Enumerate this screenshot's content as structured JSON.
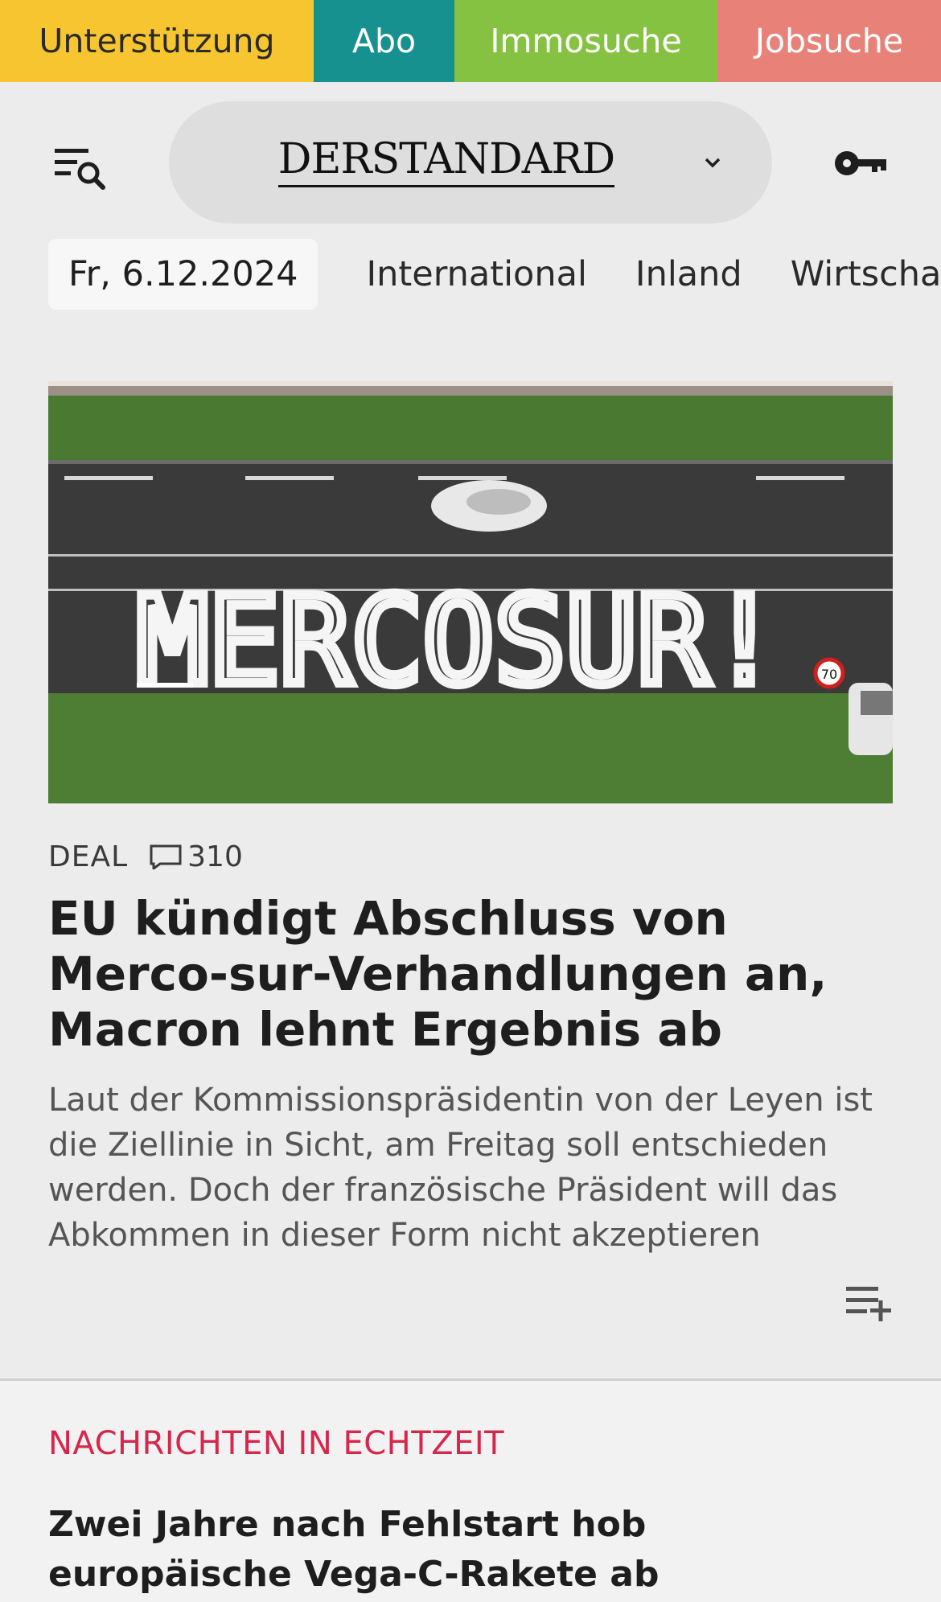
{
  "topbar": {
    "support": "Unterstützung",
    "abo": "Abo",
    "immo": "Immosuche",
    "jobs": "Jobsuche"
  },
  "header": {
    "logo": "DERSTANDARD",
    "menu_icon": "menu-search-icon",
    "dropdown_icon": "chevron-down-icon",
    "login_icon": "key-icon"
  },
  "nav": {
    "date": "Fr, 6.12.2024",
    "items": [
      "International",
      "Inland",
      "Wirtschaft"
    ]
  },
  "article": {
    "kicker": "DEAL",
    "comment_count": "310",
    "headline": "EU kündigt Abschluss von Merco-sur-Verhandlungen an, Macron lehnt Ergebnis ab",
    "teaser": "Laut der Kommissionspräsidentin von der Leyen ist die Ziellinie in Sicht, am Freitag soll entschieden werden. Doch der französische Präsident will das Abkommen in dieser Form nicht akzeptieren",
    "image_text": "MERCOSUR!",
    "speed_sign": "70"
  },
  "live": {
    "title": "NACHRICHTEN IN ECHTZEIT",
    "headline": "Zwei Jahre nach Fehlstart hob europäische Vega-C-Rakete ab"
  },
  "colors": {
    "support": "#f7c530",
    "abo": "#16918f",
    "immo": "#86c242",
    "jobs": "#e88279",
    "live_accent": "#d6264b"
  }
}
